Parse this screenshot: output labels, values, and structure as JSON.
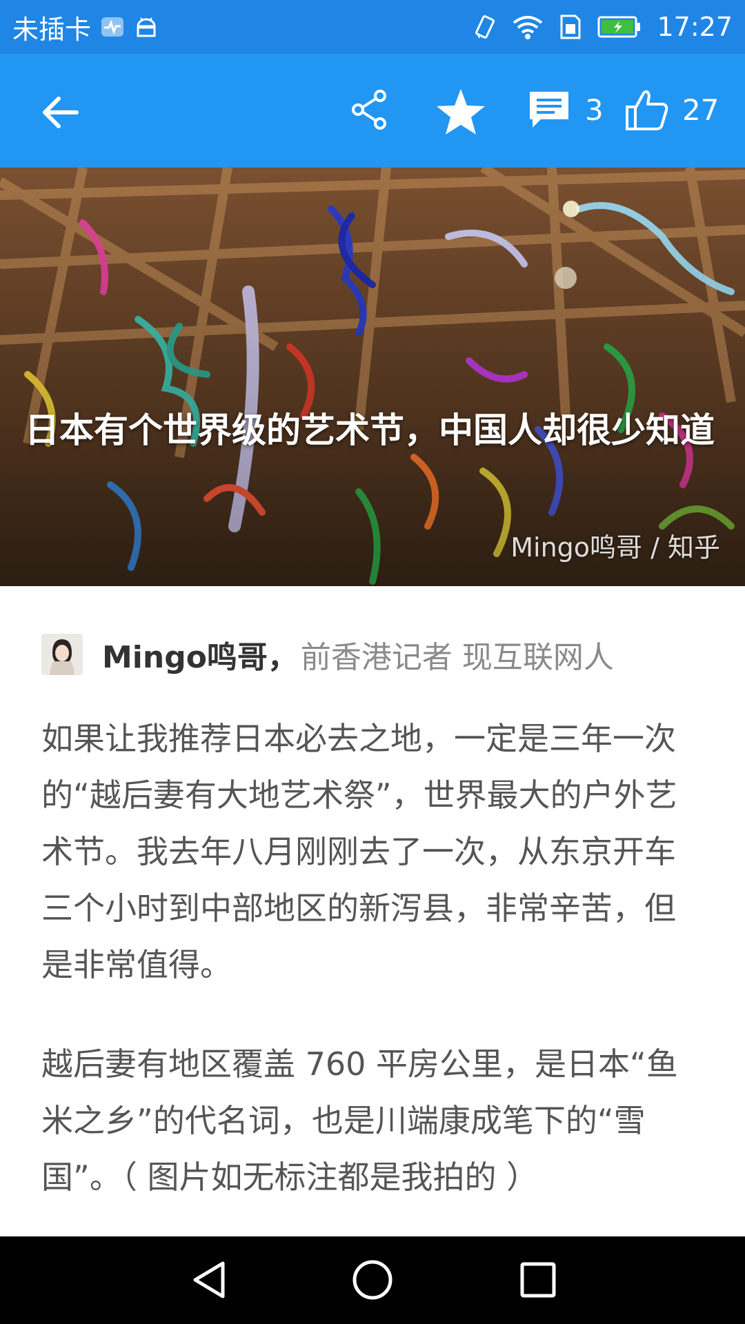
{
  "status_bar": {
    "carrier": "未插卡",
    "time": "17:27",
    "icons": [
      "health-icon",
      "android-icon",
      "vibrate-icon",
      "wifi-icon",
      "sim-icon",
      "battery-icon"
    ]
  },
  "app_bar": {
    "comment_count": "3",
    "like_count": "27",
    "accent_color": "#2196f3"
  },
  "hero": {
    "title": "日本有个世界级的艺术节，中国人却很少知道",
    "credit": "Mingo鸣哥 / 知乎"
  },
  "author": {
    "name": "Mingo鸣哥，",
    "bio": "前香港记者 现互联网人"
  },
  "article": {
    "paragraphs": [
      "如果让我推荐日本必去之地，一定是三年一次的“越后妻有大地艺术祭”，世界最大的户外艺术节。我去年八月刚刚去了一次，从东京开车三个小时到中部地区的新泻县，非常辛苦，但是非常值得。",
      "越后妻有地区覆盖 760 平房公里，是日本“鱼米之乡”的代名词，也是川端康成笔下的“雪国”。（ 图片如无标注都是我拍的 ）"
    ]
  }
}
